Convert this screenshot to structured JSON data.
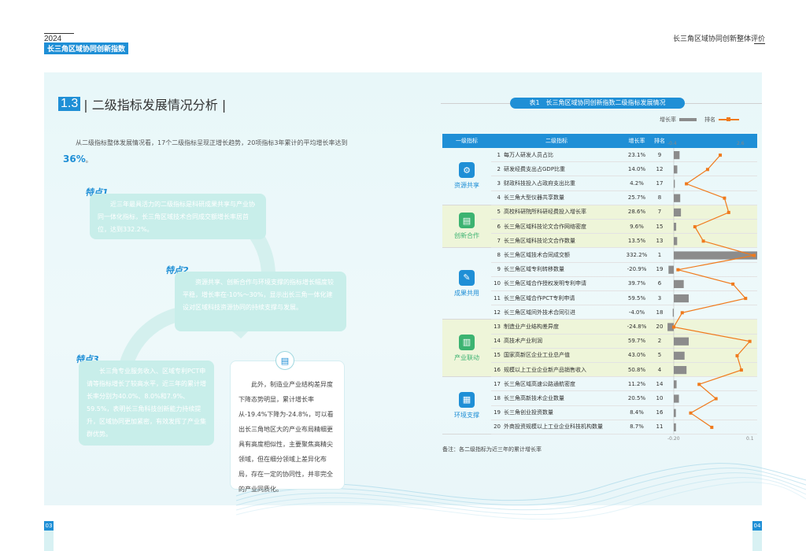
{
  "header": {
    "year": "2024",
    "report_title": "长三角区域协同创新指数",
    "right_title": "长三角区域协同创新整体评价"
  },
  "section": {
    "number": "1.3",
    "title": "| 二级指标发展情况分析 |"
  },
  "intro": {
    "text": "从二级指标整体发展情况看，17个二级指标呈现正增长趋势，20项指标3年累计的平均增长率达到",
    "highlight": "36%",
    "end": "。"
  },
  "features": [
    {
      "label": "特点1",
      "text": "近三年最具活力的二级指标是科研成果共享与产业协同一体化指标，长三角区域技术合同成交额增长率居首位，达到332.2%。"
    },
    {
      "label": "特点2",
      "text": "资源共享、创新合作与环境支撑的指标增长幅度较平稳，增长率在-10%～30%，显示出长三角一体化建设对区域科技资源协同的持续支撑与发展。"
    },
    {
      "label": "特点3",
      "text": "长三角专业服务收入、区域专利PCT申请等指标增长了较高水平，近三年的累计增长率分别为40.0%、8.0%和7.9%、59.5%，表明长三角科技创新能力持续提升，区域协同更加紧密，有效发挥了产业集群优势。"
    }
  ],
  "note": {
    "text": "此外，制造业产业结构差异度下降态势明显，累计增长率从-19.4%下降为-24.8%，可以看出长三角地区大的产业布局精细更具有高度相似性，主要聚焦高精尖领域，但在细分领域上差异化布局，存在一定的协同性，并非完全的产业同质化。"
  },
  "table": {
    "title": "表1　长三角区域协同创新指数二级指标发展情况",
    "legend_growth": "增长率",
    "legend_rank": "排名",
    "headers": [
      "一级指标",
      "二级指标",
      "增长率",
      "排名"
    ],
    "groups": [
      {
        "name": "资源共享",
        "color": "#1f8fd6",
        "icon": "⚙"
      },
      {
        "name": "创新合作",
        "color": "#3cb371",
        "icon": "▤"
      },
      {
        "name": "成果共用",
        "color": "#1f8fd6",
        "icon": "✎"
      },
      {
        "name": "产业联动",
        "color": "#3cb371",
        "icon": "▥"
      },
      {
        "name": "环境支撑",
        "color": "#1f8fd6",
        "icon": "▦"
      }
    ],
    "rows": [
      {
        "no": "1",
        "name": "每万人研发人员占比",
        "growth": "23.1%",
        "rank": "9"
      },
      {
        "no": "2",
        "name": "研发经费支出占GDP比重",
        "growth": "14.0%",
        "rank": "12"
      },
      {
        "no": "3",
        "name": "财政科技投入占政府支出比重",
        "growth": "4.2%",
        "rank": "17"
      },
      {
        "no": "4",
        "name": "长三角大型仪器共享数量",
        "growth": "25.7%",
        "rank": "8"
      },
      {
        "no": "5",
        "name": "高校科研院所科研经费投入增长率",
        "growth": "28.6%",
        "rank": "7"
      },
      {
        "no": "6",
        "name": "长三角区域科技论文合作网络密度",
        "growth": "9.6%",
        "rank": "15"
      },
      {
        "no": "7",
        "name": "长三角区域科技论文合作数量",
        "growth": "13.5%",
        "rank": "13"
      },
      {
        "no": "8",
        "name": "长三角区域技术合同成交额",
        "growth": "332.2%",
        "rank": "1"
      },
      {
        "no": "9",
        "name": "长三角区域专利转移数量",
        "growth": "-20.9%",
        "rank": "19"
      },
      {
        "no": "10",
        "name": "长三角区域合作授权发明专利申请",
        "growth": "39.7%",
        "rank": "6"
      },
      {
        "no": "11",
        "name": "长三角区域合作PCT专利申请",
        "growth": "59.5%",
        "rank": "3"
      },
      {
        "no": "12",
        "name": "长三角区域间外技术合同引进",
        "growth": "-4.0%",
        "rank": "18"
      },
      {
        "no": "13",
        "name": "制造业产业结构差异度",
        "growth": "-24.8%",
        "rank": "20"
      },
      {
        "no": "14",
        "name": "高技术产业利润",
        "growth": "59.7%",
        "rank": "2"
      },
      {
        "no": "15",
        "name": "国家高新区企业工业总产值",
        "growth": "43.0%",
        "rank": "5"
      },
      {
        "no": "16",
        "name": "规模以上工业企业新产品销售收入",
        "growth": "50.8%",
        "rank": "4"
      },
      {
        "no": "17",
        "name": "长三角区域高速公路通航密度",
        "growth": "11.2%",
        "rank": "14"
      },
      {
        "no": "18",
        "name": "长三角高新技术企业数量",
        "growth": "20.5%",
        "rank": "10"
      },
      {
        "no": "19",
        "name": "长三角创业投资数量",
        "growth": "8.4%",
        "rank": "16"
      },
      {
        "no": "20",
        "name": "外商投资规模以上工业企业科技机构数量",
        "growth": "8.7%",
        "rank": "11"
      }
    ],
    "footnote": "备注：各二级指标为近三年的累计增长率"
  },
  "chart_data": {
    "type": "bar",
    "categories": [
      "1",
      "2",
      "3",
      "4",
      "5",
      "6",
      "7",
      "8",
      "9",
      "10",
      "11",
      "12",
      "13",
      "14",
      "15",
      "16",
      "17",
      "18",
      "19",
      "20"
    ],
    "series": [
      {
        "name": "增长率",
        "values": [
          23.1,
          14.0,
          4.2,
          25.7,
          28.6,
          9.6,
          13.5,
          332.2,
          -20.9,
          39.7,
          59.5,
          -4.0,
          -24.8,
          59.7,
          43.0,
          50.8,
          11.2,
          20.5,
          8.4,
          8.7
        ]
      },
      {
        "name": "排名",
        "values": [
          9,
          12,
          17,
          8,
          7,
          15,
          13,
          1,
          19,
          6,
          3,
          18,
          20,
          2,
          5,
          4,
          14,
          10,
          16,
          11
        ]
      }
    ],
    "axis_top": [
      "-0.4",
      "2.6"
    ],
    "axis_bottom": [
      "-0.20",
      "0.1"
    ]
  },
  "pages": {
    "left": "03",
    "right": "04"
  },
  "colors": {
    "accent": "#1f8fd6",
    "rank_line": "#f07a1c",
    "bar": "#8c8c8c",
    "shade": "#eef5d9"
  }
}
